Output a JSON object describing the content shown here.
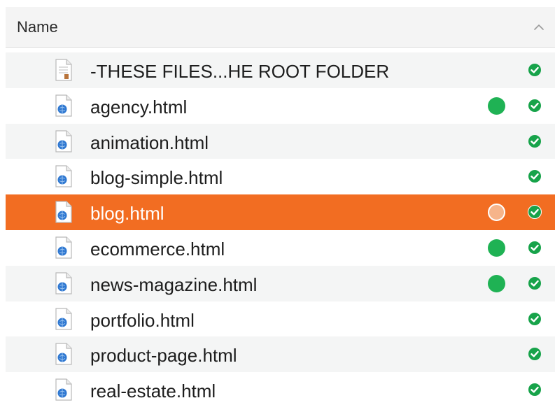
{
  "header": {
    "label": "Name"
  },
  "colors": {
    "selection": "#f26d22",
    "modified_dot": "#1fb254",
    "synced_check": "#17a34a"
  },
  "files": [
    {
      "name": "-THESE FILES...HE ROOT FOLDER",
      "kind": "text-document-icon",
      "dot": "none",
      "selected": false
    },
    {
      "name": "agency.html",
      "kind": "html-file-icon",
      "dot": "green",
      "selected": false
    },
    {
      "name": "animation.html",
      "kind": "html-file-icon",
      "dot": "none",
      "selected": false
    },
    {
      "name": "blog-simple.html",
      "kind": "html-file-icon",
      "dot": "none",
      "selected": false
    },
    {
      "name": "blog.html",
      "kind": "html-file-icon",
      "dot": "orange",
      "selected": true
    },
    {
      "name": "ecommerce.html",
      "kind": "html-file-icon",
      "dot": "green",
      "selected": false
    },
    {
      "name": "news-magazine.html",
      "kind": "html-file-icon",
      "dot": "green",
      "selected": false
    },
    {
      "name": "portfolio.html",
      "kind": "html-file-icon",
      "dot": "none",
      "selected": false
    },
    {
      "name": "product-page.html",
      "kind": "html-file-icon",
      "dot": "none",
      "selected": false
    },
    {
      "name": "real-estate.html",
      "kind": "html-file-icon",
      "dot": "none",
      "selected": false
    }
  ]
}
